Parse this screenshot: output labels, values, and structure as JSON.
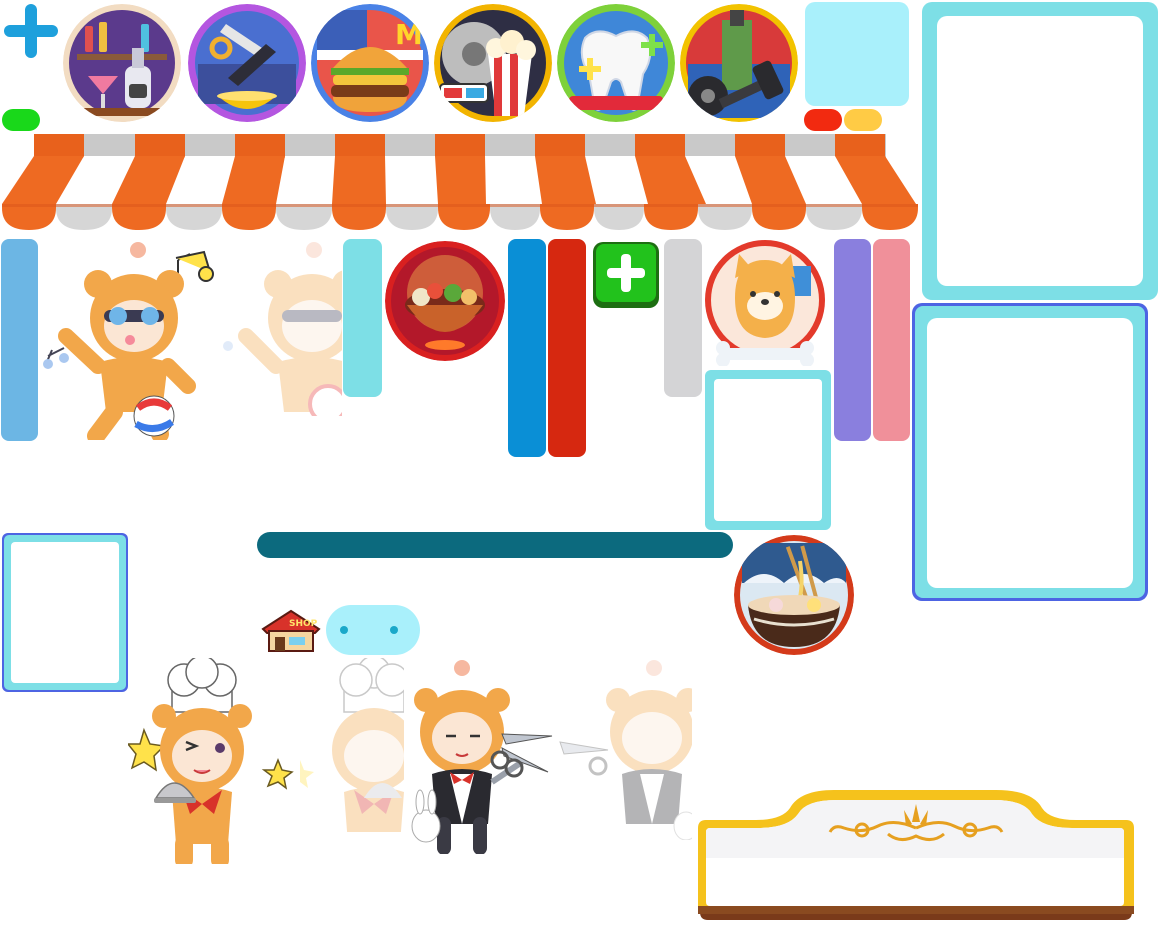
{
  "atlas": {
    "icons": [
      {
        "name": "cocktail-bar-icon",
        "ring": "#f2dcc2"
      },
      {
        "name": "salon-tools-icon",
        "ring": "#b456e0"
      },
      {
        "name": "burger-shop-icon",
        "ring": "#4a82e6"
      },
      {
        "name": "cinema-popcorn-icon",
        "ring": "#f2b400"
      },
      {
        "name": "dental-clinic-icon",
        "ring": "#7ed13a"
      },
      {
        "name": "gym-dumbbell-icon",
        "ring": "#f2c300"
      },
      {
        "name": "hotpot-icon",
        "ring": "#d92020"
      },
      {
        "name": "shiba-pet-shop-icon",
        "ring": "#e33a2b"
      },
      {
        "name": "ramen-shop-icon",
        "ring": "#d43a1a"
      }
    ],
    "shop_badge_text": "SHOP",
    "colors": {
      "awning_orange": "#ee6a22",
      "awning_grey": "#c9c9c9",
      "panel_cyan": "#7ddfe6",
      "panel_blue": "#4d64e3",
      "progress_teal": "#0c6a7e",
      "plus_blue": "#1ea0dc",
      "plus_green": "#19c21a",
      "gold_frame": "#f5c21c"
    }
  }
}
